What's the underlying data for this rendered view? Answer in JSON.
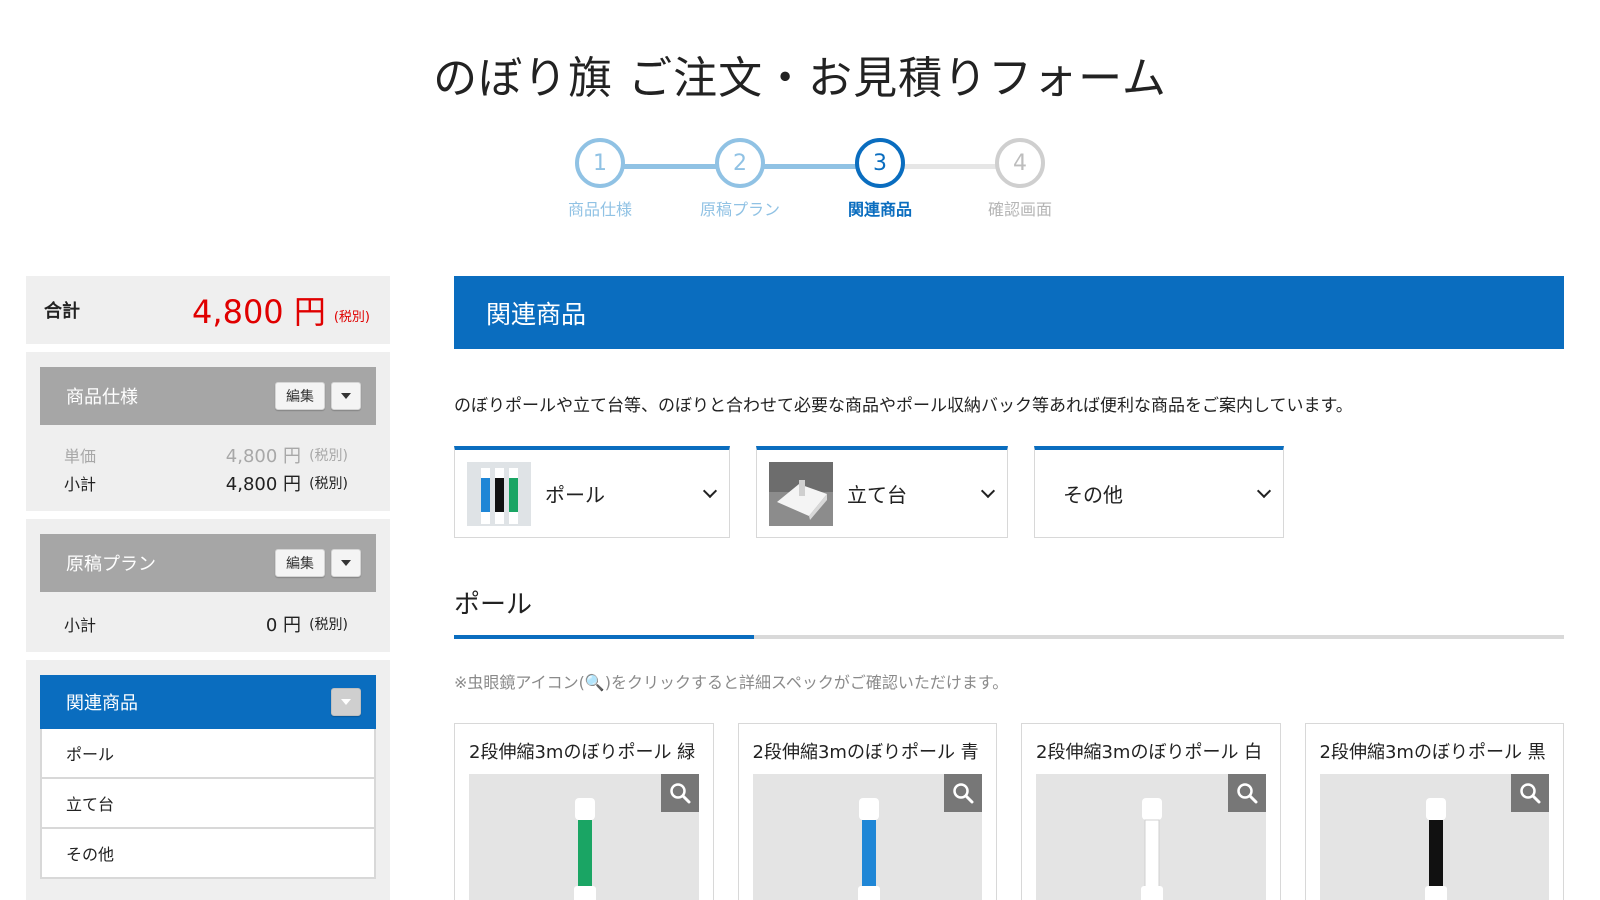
{
  "page": {
    "title": "のぼり旗 ご注文・お見積りフォーム"
  },
  "stepper": {
    "steps": [
      {
        "number": "1",
        "label": "商品仕様",
        "state": "done"
      },
      {
        "number": "2",
        "label": "原稿プラン",
        "state": "done"
      },
      {
        "number": "3",
        "label": "関連商品",
        "state": "active"
      },
      {
        "number": "4",
        "label": "確認画面",
        "state": "todo"
      }
    ]
  },
  "sidebar": {
    "total": {
      "label": "合計",
      "amount": "4,800 円",
      "tax": "(税別)"
    },
    "spec": {
      "title": "商品仕様",
      "edit_label": "編集",
      "unit_price_label": "単価",
      "unit_price_amount": "4,800 円",
      "unit_price_tax": "(税別)",
      "subtotal_label": "小計",
      "subtotal_amount": "4,800 円",
      "subtotal_tax": "(税別)"
    },
    "plan": {
      "title": "原稿プラン",
      "edit_label": "編集",
      "subtotal_label": "小計",
      "subtotal_amount": "0 円",
      "subtotal_tax": "(税別)"
    },
    "related": {
      "title": "関連商品",
      "items": [
        "ポール",
        "立て台",
        "その他"
      ]
    }
  },
  "main": {
    "section_title": "関連商品",
    "intro": "のぼりポールや立て台等、のぼりと合わせて必要な商品やポール収納バック等あれば便利な商品をご案内しています。",
    "categories": [
      {
        "label": "ポール",
        "icon": "pole-thumbnail"
      },
      {
        "label": "立て台",
        "icon": "stand-thumbnail"
      },
      {
        "label": "その他"
      }
    ],
    "subsection_title": "ポール",
    "note": "※虫眼鏡アイコン(🔍)をクリックすると詳細スペックがご確認いただけます。",
    "products": [
      {
        "name": "2段伸縮3mのぼりポール 緑",
        "color": "#1aa564"
      },
      {
        "name": "2段伸縮3mのぼりポール 青",
        "color": "#1f86d6"
      },
      {
        "name": "2段伸縮3mのぼりポール 白",
        "color": "#ffffff"
      },
      {
        "name": "2段伸縮3mのぼりポール 黒",
        "color": "#111111"
      }
    ]
  },
  "colors": {
    "primary": "#0a6dbf",
    "price": "#e00000",
    "panel_head": "#a6a6a6"
  }
}
